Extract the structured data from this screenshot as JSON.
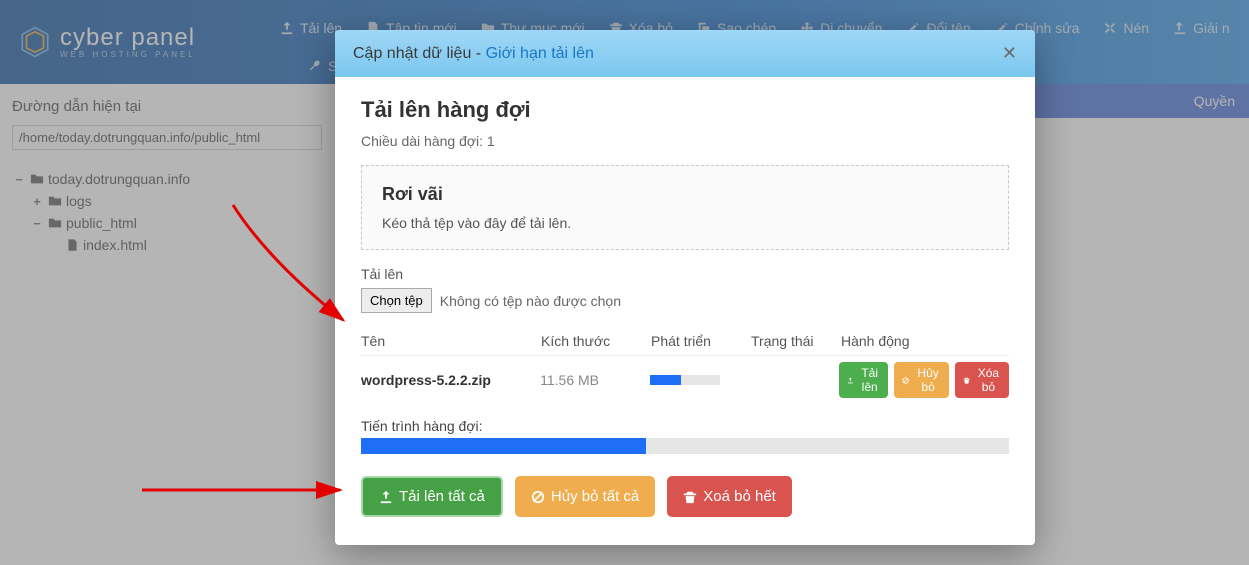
{
  "header": {
    "brand": "cyber panel",
    "brand_sub": "WEB HOSTING PANEL",
    "toolbar": [
      {
        "icon": "upload-icon",
        "label": "Tải lên"
      },
      {
        "icon": "new-file-icon",
        "label": "Tập tin mới"
      },
      {
        "icon": "new-folder-icon",
        "label": "Thư mục mới"
      },
      {
        "icon": "trash-icon",
        "label": "Xóa bỏ"
      },
      {
        "icon": "copy-icon",
        "label": "Sao chép"
      },
      {
        "icon": "move-icon",
        "label": "Di chuyển"
      },
      {
        "icon": "rename-icon",
        "label": "Đổi tên"
      },
      {
        "icon": "edit-icon",
        "label": "Chỉnh sửa"
      },
      {
        "icon": "compress-icon",
        "label": "Nén"
      },
      {
        "icon": "extract-icon",
        "label": "Giải n"
      }
    ],
    "toolbar2_label": "Sử"
  },
  "sidebar": {
    "path_label": "Đường dẫn hiện tại",
    "path_value": "/home/today.dotrungquan.info/public_html",
    "tree": {
      "root": {
        "expanded": true,
        "name": "today.dotrungquan.info"
      },
      "logs": {
        "name": "logs"
      },
      "public_html": {
        "expanded": true,
        "name": "public_html"
      },
      "index": {
        "name": "index.html"
      }
    }
  },
  "filepanel": {
    "perm_header": "Quyền"
  },
  "modal": {
    "title_a": "Cập nhật dữ liệu - ",
    "title_b": "Giới hạn tải lên",
    "heading": "Tải lên hàng đợi",
    "queue_len_label": "Chiều dài hàng đợi: 1",
    "drop": {
      "title": "Rơi vãi",
      "hint": "Kéo thả tệp vào đây để tải lên."
    },
    "upload_label": "Tải lên",
    "choose_btn": "Chọn tệp",
    "no_file": "Không có tệp nào được chọn",
    "headers": {
      "name": "Tên",
      "size": "Kích thước",
      "progress": "Phát triển",
      "status": "Trạng thái",
      "action": "Hành động"
    },
    "file": {
      "name": "wordpress-5.2.2.zip",
      "size": "11.56 MB"
    },
    "row_actions": {
      "upload": "Tải lên",
      "cancel": "Hủy bỏ",
      "remove": "Xóa bỏ"
    },
    "progress_label": "Tiến trình hàng đợi:",
    "actions": {
      "upload_all": "Tải lên tất cả",
      "cancel_all": "Hủy bỏ tất cả",
      "remove_all": "Xoá bỏ hết"
    }
  }
}
